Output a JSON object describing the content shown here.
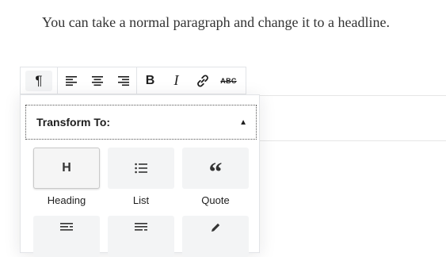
{
  "intro_text": "You can take a normal paragraph and change it to a headline.",
  "ghost_text": "·· · ·",
  "toolbar": {
    "block_switcher_glyph": "¶",
    "bold_label": "B",
    "italic_label": "I",
    "strike_label": "ABC"
  },
  "transform": {
    "header_label": "Transform To:",
    "caret_glyph": "▲",
    "items": [
      {
        "label": "Heading",
        "glyph": "H"
      },
      {
        "label": "List",
        "glyph": ""
      },
      {
        "label": "Quote",
        "glyph": "“"
      }
    ]
  },
  "colors": {
    "border": "#e2e4e7",
    "tile_bg": "#f3f4f5",
    "text": "#1e1e1e"
  }
}
